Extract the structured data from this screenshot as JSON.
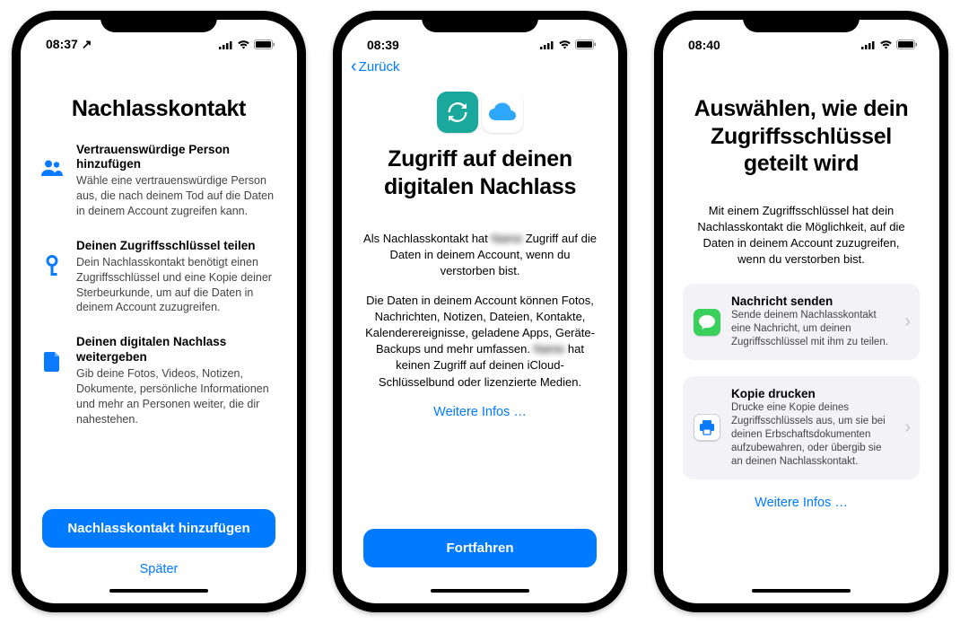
{
  "phones": [
    {
      "status": {
        "time": "08:37",
        "location_arrow": "↗"
      },
      "title": "Nachlasskontakt",
      "features": [
        {
          "title": "Vertrauenswürdige Person hinzufügen",
          "desc": "Wähle eine vertrauenswürdige Person aus, die nach deinem Tod auf die Daten in deinem Account zugreifen kann."
        },
        {
          "title": "Deinen Zugriffsschlüssel teilen",
          "desc": "Dein Nachlasskontakt benötigt einen Zugriffsschlüssel und eine Kopie deiner Sterbeurkunde, um auf die Daten in deinem Account zuzugreifen."
        },
        {
          "title": "Deinen digitalen Nachlass weitergeben",
          "desc": "Gib deine Fotos, Videos, Notizen, Dokumente, persönliche Informationen und mehr an Personen weiter, die dir nahestehen."
        }
      ],
      "primary": "Nachlasskontakt hinzufügen",
      "secondary": "Später"
    },
    {
      "status": {
        "time": "08:39"
      },
      "back": "Zurück",
      "title": "Zugriff auf deinen digitalen Nachlass",
      "para1_a": "Als Nachlasskontakt hat ",
      "para1_blur": "Name",
      "para1_b": " Zugriff auf die Daten in deinem Account, wenn du verstorben bist.",
      "para2_a": "Die Daten in deinem Account können Fotos, Nachrichten, Notizen, Dateien, Kontakte, Kalenderereignisse, geladene Apps, Geräte-Backups und mehr umfassen. ",
      "para2_blur": "Name",
      "para2_b": " hat keinen Zugriff auf deinen iCloud-Schlüsselbund oder lizenzierte Medien.",
      "more": "Weitere Infos …",
      "primary": "Fortfahren"
    },
    {
      "status": {
        "time": "08:40"
      },
      "title": "Auswählen, wie dein Zugriffsschlüssel geteilt wird",
      "intro": "Mit einem Zugriffsschlüssel hat dein Nachlasskontakt die Möglichkeit, auf die Daten in deinem Account zuzugreifen, wenn du verstorben bist.",
      "options": [
        {
          "title": "Nachricht senden",
          "desc": "Sende deinem Nachlasskontakt eine Nachricht, um deinen Zugriffsschlüssel mit ihm zu teilen."
        },
        {
          "title": "Kopie drucken",
          "desc": "Drucke eine Kopie deines Zugriffsschlüssels aus, um sie bei deinen Erbschaftsdokumenten aufzubewahren, oder übergib sie an deinen Nachlasskontakt."
        }
      ],
      "more": "Weitere Infos …"
    }
  ]
}
